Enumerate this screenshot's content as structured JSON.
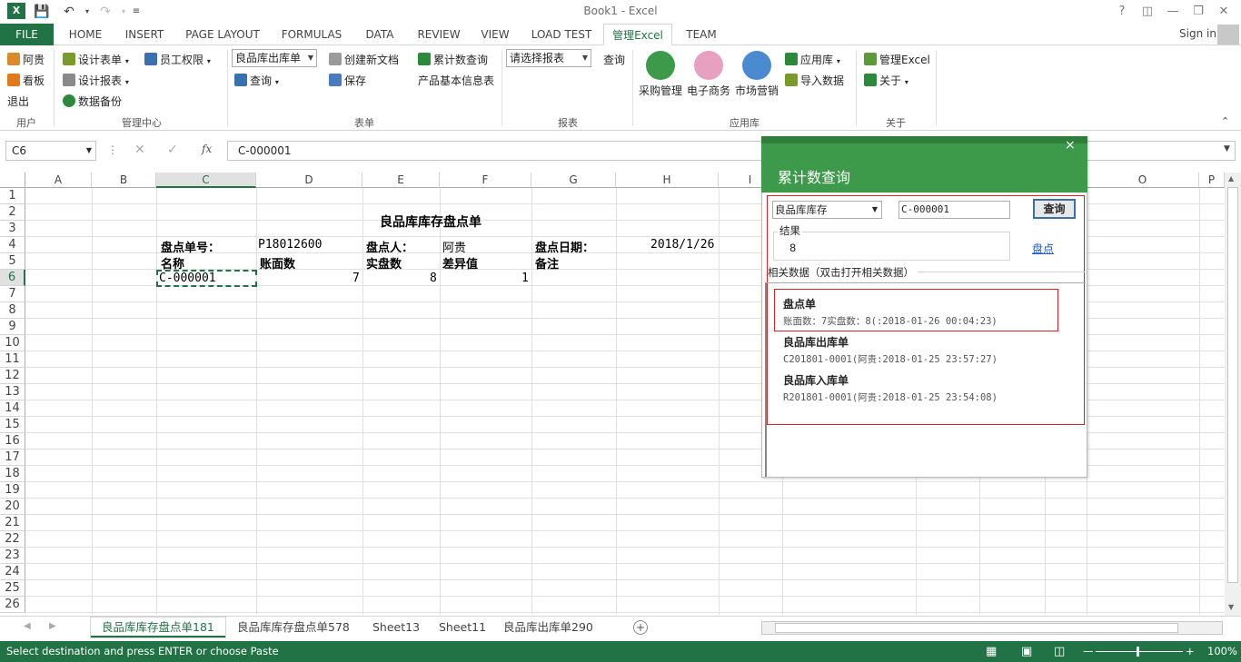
{
  "window": {
    "title": "Book1 - Excel",
    "logo": "X",
    "help": "?",
    "sign_in": "Sign in"
  },
  "tabs": [
    "FILE",
    "HOME",
    "INSERT",
    "PAGE LAYOUT",
    "FORMULAS",
    "DATA",
    "REVIEW",
    "VIEW",
    "LOAD TEST",
    "管理Excel",
    "TEAM"
  ],
  "ribbon": {
    "user": {
      "items": [
        "阿贵",
        "看板",
        "退出"
      ],
      "group": "用户"
    },
    "manage": {
      "items": [
        "设计表单",
        "员工权限",
        "设计报表",
        "数据备份"
      ],
      "group": "管理中心"
    },
    "form": {
      "combo": "良品库出库单",
      "items": [
        "查询",
        "创建新文档",
        "保存",
        "累计数查询",
        "产品基本信息表"
      ],
      "group": "表单"
    },
    "report": {
      "combo": "请选择报表",
      "query": "查询",
      "group": "报表"
    },
    "applib": {
      "items": [
        "采购管理",
        "电子商务",
        "市场营销",
        "应用库",
        "导入数据"
      ],
      "group": "应用库"
    },
    "about": {
      "items": [
        "管理Excel",
        "关于"
      ],
      "group": "关于"
    }
  },
  "formula_bar": {
    "name_box": "C6",
    "fx": "fx",
    "formula": "C-000001"
  },
  "columns": [
    "A",
    "B",
    "C",
    "D",
    "E",
    "F",
    "G",
    "H",
    "I",
    "O",
    "P"
  ],
  "rows": [
    "1",
    "2",
    "3",
    "4",
    "5",
    "6",
    "7",
    "8",
    "9",
    "10",
    "11",
    "12",
    "13",
    "14",
    "15",
    "16",
    "17",
    "18",
    "19",
    "20",
    "21",
    "22",
    "23",
    "24",
    "25",
    "26"
  ],
  "sheet": {
    "title": "良品库库存盘点单",
    "r4": {
      "c": "盘点单号：",
      "d": "P18012600",
      "e": "盘点人：",
      "f": "阿贵",
      "g": "盘点日期：",
      "h": "2018/1/26"
    },
    "r5": {
      "c": "名称",
      "d": "账面数",
      "e": "实盘数",
      "f": "差异值",
      "g": "备注"
    },
    "r6": {
      "c": "C-000001",
      "d": "7",
      "e": "8",
      "f": "1"
    }
  },
  "sheet_tabs": [
    "良品库库存盘点单181",
    "良品库库存盘点单578",
    "Sheet13",
    "Sheet11",
    "良品库出库单290"
  ],
  "status": {
    "message": "Select destination and press ENTER or choose Paste",
    "zoom": "100%"
  },
  "dialog": {
    "title": "累计数查询",
    "close": "×",
    "select": "良品库库存",
    "input": "C-000001",
    "query_button": "查询",
    "result_label": "结果",
    "result_value": "8",
    "link": "盘点",
    "related_label": "相关数据（双击打开相关数据）",
    "items": [
      {
        "title": "盘点单",
        "detail": "账面数：7实盘数：8(:2018-01-26 00:04:23)"
      },
      {
        "title": "良品库出库单",
        "detail": "C201801-0001(阿贵:2018-01-25 23:57:27)"
      },
      {
        "title": "良品库入库单",
        "detail": "R201801-0001(阿贵:2018-01-25 23:54:08)"
      }
    ]
  },
  "colors": {
    "excel_green": "#217346",
    "dialog_green": "#3c9a4a",
    "highlight_red": "#e02020"
  }
}
